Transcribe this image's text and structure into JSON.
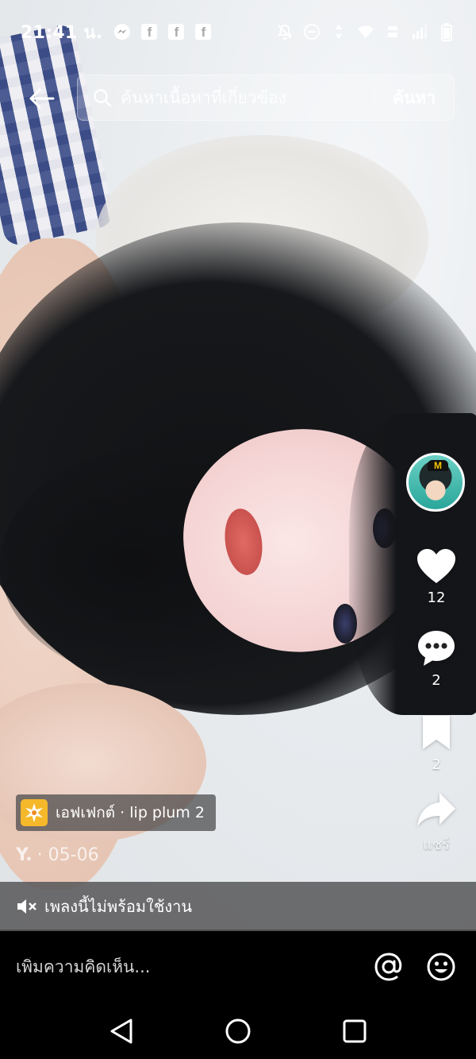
{
  "status_bar": {
    "time": "21:41 น.",
    "left_icons": [
      "messenger-icon",
      "facebook-icon",
      "facebook-icon",
      "facebook-icon"
    ],
    "right_icons": [
      "bell-off-icon",
      "do-not-disturb-icon",
      "data-arrows-icon",
      "wifi-icon",
      "volte-icon",
      "signal-icon",
      "battery-icon"
    ]
  },
  "header": {
    "back_icon": "arrow-left-icon",
    "search_placeholder": "ค้นหาเนื้อหาที่เกี่ยวข้อง",
    "search_button": "ค้นหา"
  },
  "actions": {
    "like_count": "12",
    "comment_count": "2",
    "save_count": "2",
    "share_label": "แชร์"
  },
  "post": {
    "effect_label": "เอฟเฟกต์ · lip plum 2",
    "author": "Y.",
    "date": "· 05-06"
  },
  "music": {
    "text": "เพลงนี้ไม่พร้อมใช้งาน"
  },
  "comment": {
    "placeholder": "เพิ่มความคิดเห็น..."
  },
  "colors": {
    "effect_icon_bg": "#f5b82a",
    "music_bar_bg": "#5a5a5c",
    "comment_bar_bg": "#000000"
  }
}
